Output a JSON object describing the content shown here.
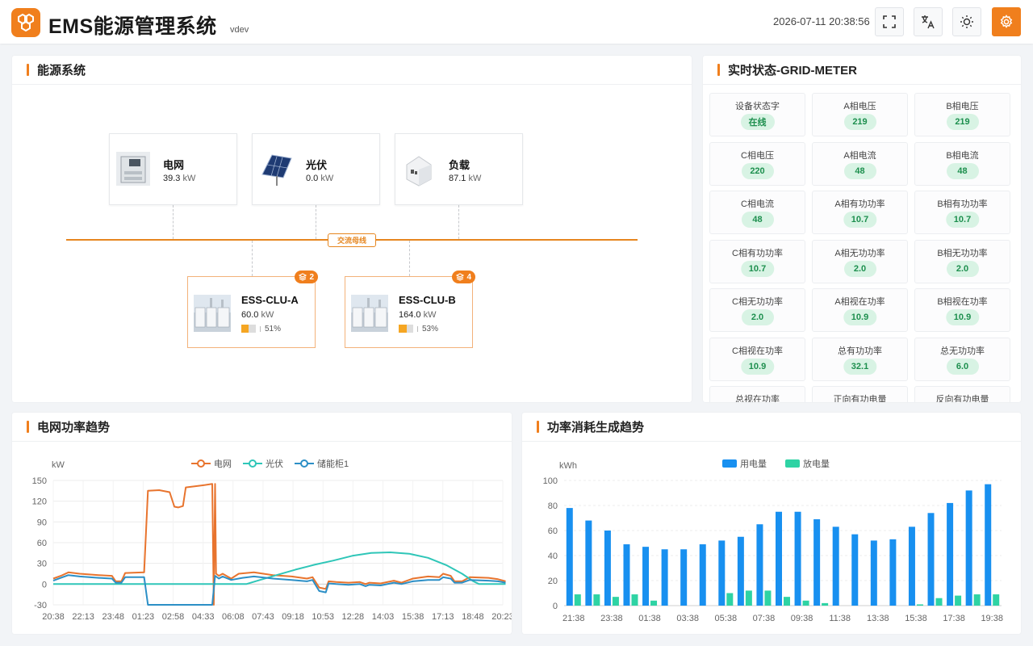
{
  "header": {
    "title": "EMS能源管理系统",
    "version": "vdev",
    "datetime": "2026-07-11 20:38:56",
    "buttons": [
      "fullscreen-icon",
      "translate-icon",
      "theme-sun-icon",
      "settings-gear-icon"
    ],
    "accent": "#f07f1d"
  },
  "energy": {
    "title": "能源系统",
    "bus_label": "交流母线",
    "unit": "kW",
    "nodes": [
      {
        "name": "电网",
        "value": "39.3"
      },
      {
        "name": "光伏",
        "value": "0.0"
      },
      {
        "name": "负载",
        "value": "87.1"
      }
    ],
    "ess": [
      {
        "name": "ESS-CLU-A",
        "value": "60.0",
        "soc": "51%",
        "soc_value": 0.51,
        "badge": "2"
      },
      {
        "name": "ESS-CLU-B",
        "value": "164.0",
        "soc": "53%",
        "soc_value": 0.53,
        "badge": "4"
      }
    ]
  },
  "realtime": {
    "title": "实时状态-GRID-METER",
    "items": [
      {
        "label": "设备状态字",
        "value": "在线"
      },
      {
        "label": "A相电压",
        "value": "219"
      },
      {
        "label": "B相电压",
        "value": "219"
      },
      {
        "label": "C相电压",
        "value": "220"
      },
      {
        "label": "A相电流",
        "value": "48"
      },
      {
        "label": "B相电流",
        "value": "48"
      },
      {
        "label": "C相电流",
        "value": "48"
      },
      {
        "label": "A相有功功率",
        "value": "10.7"
      },
      {
        "label": "B相有功功率",
        "value": "10.7"
      },
      {
        "label": "C相有功功率",
        "value": "10.7"
      },
      {
        "label": "A相无功功率",
        "value": "2.0"
      },
      {
        "label": "B相无功功率",
        "value": "2.0"
      },
      {
        "label": "C相无功功率",
        "value": "2.0"
      },
      {
        "label": "A相视在功率",
        "value": "10.9"
      },
      {
        "label": "B相视在功率",
        "value": "10.9"
      },
      {
        "label": "C相视在功率",
        "value": "10.9"
      },
      {
        "label": "总有功功率",
        "value": "32.1"
      },
      {
        "label": "总无功功率",
        "value": "6.0"
      },
      {
        "label": "总视在功率",
        "value": ""
      },
      {
        "label": "正向有功电量",
        "value": ""
      },
      {
        "label": "反向有功电量",
        "value": ""
      }
    ]
  },
  "chart_data": [
    {
      "type": "line",
      "title": "电网功率趋势",
      "ylabel": "kW",
      "ylim": [
        -30,
        150
      ],
      "yticks": [
        -30,
        0,
        30,
        60,
        90,
        120,
        150
      ],
      "grid": true,
      "legend_position": "top-center",
      "xtick_labels": [
        "20:38",
        "22:13",
        "23:48",
        "01:23",
        "02:58",
        "04:33",
        "06:08",
        "07:43",
        "09:18",
        "10:53",
        "12:28",
        "14:03",
        "15:38",
        "17:13",
        "18:48",
        "20:23"
      ],
      "x_hours": [
        0,
        1.583,
        3.167,
        4.75,
        6.333,
        7.917,
        9.5,
        11.083,
        12.667,
        14.25,
        15.833,
        17.417,
        19.0,
        20.583,
        22.167,
        23.75
      ],
      "series": [
        {
          "name": "电网",
          "color": "#e8742e",
          "points": [
            [
              0,
              8
            ],
            [
              0.4,
              12
            ],
            [
              0.8,
              17
            ],
            [
              1.4,
              15
            ],
            [
              2.4,
              13
            ],
            [
              3.1,
              12
            ],
            [
              3.3,
              4
            ],
            [
              3.6,
              4
            ],
            [
              3.8,
              16
            ],
            [
              4.8,
              17
            ],
            [
              5.0,
              135
            ],
            [
              5.6,
              136
            ],
            [
              6.15,
              133
            ],
            [
              6.4,
              112
            ],
            [
              6.6,
              111
            ],
            [
              6.85,
              113
            ],
            [
              7.0,
              140
            ],
            [
              7.9,
              143
            ],
            [
              8.4,
              145
            ],
            [
              8.48,
              -30
            ],
            [
              8.55,
              145
            ],
            [
              8.6,
              15
            ],
            [
              8.75,
              12
            ],
            [
              8.95,
              15
            ],
            [
              9.2,
              11
            ],
            [
              9.4,
              8
            ],
            [
              9.8,
              15
            ],
            [
              10.6,
              17
            ],
            [
              11.6,
              13
            ],
            [
              12.6,
              11
            ],
            [
              13.4,
              8
            ],
            [
              13.7,
              10
            ],
            [
              14.05,
              -5
            ],
            [
              14.4,
              -7
            ],
            [
              14.55,
              4
            ],
            [
              14.95,
              3
            ],
            [
              15.6,
              2
            ],
            [
              16.2,
              3
            ],
            [
              16.5,
              0
            ],
            [
              16.7,
              2
            ],
            [
              17.3,
              1
            ],
            [
              18.0,
              5
            ],
            [
              18.4,
              2
            ],
            [
              19.0,
              8
            ],
            [
              19.8,
              11
            ],
            [
              20.4,
              10
            ],
            [
              20.6,
              15
            ],
            [
              21.0,
              12
            ],
            [
              21.2,
              4
            ],
            [
              21.6,
              4
            ],
            [
              22.0,
              10
            ],
            [
              23.0,
              9
            ],
            [
              23.5,
              7
            ],
            [
              23.9,
              4
            ]
          ]
        },
        {
          "name": "光伏",
          "color": "#2fc6b8",
          "points": [
            [
              0,
              0
            ],
            [
              10.2,
              0
            ],
            [
              10.8,
              5
            ],
            [
              11.8,
              13
            ],
            [
              12.8,
              21
            ],
            [
              13.8,
              28
            ],
            [
              14.8,
              34
            ],
            [
              15.8,
              41
            ],
            [
              16.8,
              45
            ],
            [
              17.8,
              46
            ],
            [
              18.8,
              44
            ],
            [
              19.8,
              38
            ],
            [
              20.8,
              27
            ],
            [
              21.6,
              15
            ],
            [
              22.2,
              4
            ],
            [
              22.5,
              0
            ],
            [
              23.9,
              0
            ]
          ]
        },
        {
          "name": "储能柜1",
          "color": "#2c8fc6",
          "points": [
            [
              0,
              5
            ],
            [
              0.4,
              9
            ],
            [
              0.8,
              13
            ],
            [
              1.4,
              11
            ],
            [
              2.4,
              9
            ],
            [
              3.1,
              8
            ],
            [
              3.3,
              2
            ],
            [
              3.6,
              2
            ],
            [
              3.8,
              10
            ],
            [
              4.8,
              10
            ],
            [
              5.0,
              -30
            ],
            [
              8.4,
              -30
            ],
            [
              8.55,
              12
            ],
            [
              8.75,
              8
            ],
            [
              8.95,
              11
            ],
            [
              9.4,
              6
            ],
            [
              10.0,
              9
            ],
            [
              10.6,
              11
            ],
            [
              11.6,
              8
            ],
            [
              12.6,
              6
            ],
            [
              13.4,
              4
            ],
            [
              13.7,
              6
            ],
            [
              14.05,
              -10
            ],
            [
              14.4,
              -12
            ],
            [
              14.55,
              1
            ],
            [
              14.95,
              0
            ],
            [
              15.6,
              -1
            ],
            [
              16.2,
              0
            ],
            [
              16.5,
              -3
            ],
            [
              16.7,
              -1
            ],
            [
              17.3,
              -2
            ],
            [
              18.0,
              2
            ],
            [
              18.4,
              0
            ],
            [
              19.0,
              4
            ],
            [
              19.8,
              6
            ],
            [
              20.4,
              6
            ],
            [
              20.6,
              10
            ],
            [
              21.0,
              8
            ],
            [
              21.2,
              2
            ],
            [
              21.6,
              2
            ],
            [
              22.0,
              6
            ],
            [
              23.0,
              5
            ],
            [
              23.5,
              4
            ],
            [
              23.9,
              2
            ]
          ]
        }
      ]
    },
    {
      "type": "bar",
      "title": "功率消耗生成趋势",
      "ylabel": "kWh",
      "ylim": [
        0,
        100
      ],
      "yticks": [
        0,
        20,
        40,
        60,
        80,
        100
      ],
      "grid": true,
      "legend_position": "top-center",
      "categories": [
        "21:38",
        "22:38",
        "23:38",
        "00:38",
        "01:38",
        "02:38",
        "03:38",
        "04:38",
        "05:38",
        "06:38",
        "07:38",
        "08:38",
        "09:38",
        "10:38",
        "11:38",
        "12:38",
        "13:38",
        "14:38",
        "15:38",
        "16:38",
        "17:38",
        "18:38",
        "19:38"
      ],
      "xtick_labels": [
        "21:38",
        "23:38",
        "01:38",
        "03:38",
        "05:38",
        "07:38",
        "09:38",
        "11:38",
        "13:38",
        "15:38",
        "17:38",
        "19:38"
      ],
      "series": [
        {
          "name": "用电量",
          "color": "#1890f0",
          "values": [
            78,
            68,
            60,
            49,
            47,
            45,
            45,
            49,
            52,
            55,
            65,
            75,
            75,
            69,
            63,
            57,
            52,
            53,
            63,
            74,
            82,
            92,
            97
          ]
        },
        {
          "name": "放电量",
          "color": "#2ed3a4",
          "values": [
            9,
            9,
            7,
            9,
            4,
            0,
            0,
            0,
            10,
            12,
            12,
            7,
            4,
            2,
            0,
            0,
            0,
            0,
            1,
            6,
            8,
            9,
            9
          ]
        }
      ]
    }
  ]
}
